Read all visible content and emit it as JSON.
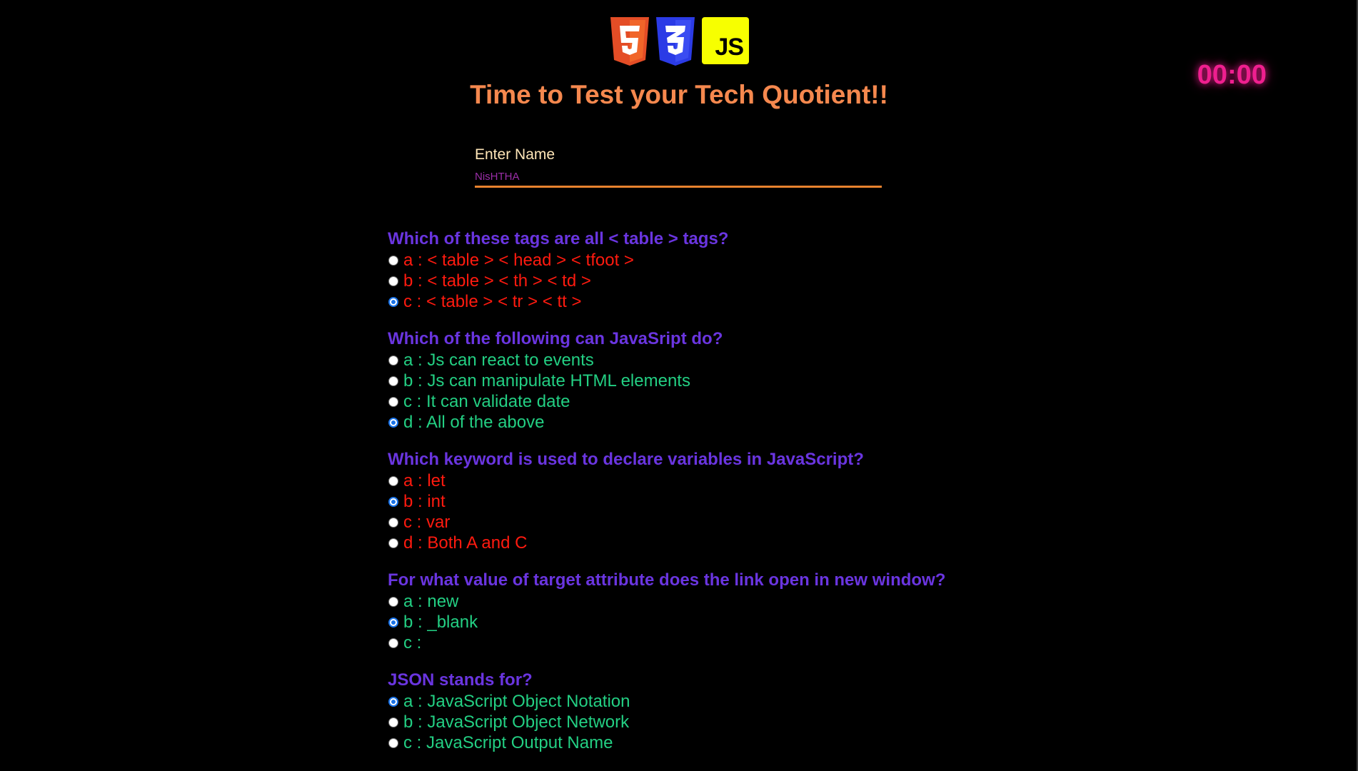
{
  "header": {
    "logos": [
      {
        "icon": "html5-logo-icon",
        "color": "#e44d26",
        "glyph": "5"
      },
      {
        "icon": "css3-logo-icon",
        "color": "#2b3be6",
        "glyph": "3"
      },
      {
        "icon": "javascript-logo-icon",
        "color": "#f7ff00",
        "glyph": "JS"
      }
    ],
    "title": "Time to Test your Tech Quotient!!",
    "timer": "00:00"
  },
  "name_field": {
    "label": "Enter Name",
    "value": "NisHTHA"
  },
  "colors": {
    "background": "#000000",
    "title": "#f5884e",
    "timer": "#ef1f8f",
    "question": "#6a35e0",
    "option_red": "#ff1a0f",
    "option_green": "#23cf83",
    "input_underline": "#e8822e",
    "input_text": "#9b2ea8"
  },
  "questions": [
    {
      "text": "Which of these tags are all < table > tags?",
      "options": [
        {
          "label": "a : < table > < head > < tfoot >",
          "selected": false
        },
        {
          "label": "b : < table > < th > < td >",
          "selected": false
        },
        {
          "label": "c : < table > < tr > < tt >",
          "selected": true
        }
      ]
    },
    {
      "text": "Which of the following can JavaSript do?",
      "options": [
        {
          "label": "a : Js can react to events",
          "selected": false
        },
        {
          "label": "b : Js can manipulate HTML elements",
          "selected": false
        },
        {
          "label": "c : It can validate date",
          "selected": false
        },
        {
          "label": "d : All of the above",
          "selected": true
        }
      ]
    },
    {
      "text": "Which keyword is used to declare variables in JavaScript?",
      "options": [
        {
          "label": "a : let",
          "selected": false
        },
        {
          "label": "b : int",
          "selected": true
        },
        {
          "label": "c : var",
          "selected": false
        },
        {
          "label": "d : Both A and C",
          "selected": false
        }
      ]
    },
    {
      "text": "For what value of target attribute does the link open in new window?",
      "options": [
        {
          "label": "a : new",
          "selected": false
        },
        {
          "label": "b : _blank",
          "selected": true
        },
        {
          "label": "c :",
          "selected": false
        }
      ]
    },
    {
      "text": "JSON stands for?",
      "options": [
        {
          "label": "a : JavaScript Object Notation",
          "selected": true
        },
        {
          "label": "b : JavaScript Object Network",
          "selected": false
        },
        {
          "label": "c : JavaScript Output Name",
          "selected": false
        }
      ]
    }
  ]
}
